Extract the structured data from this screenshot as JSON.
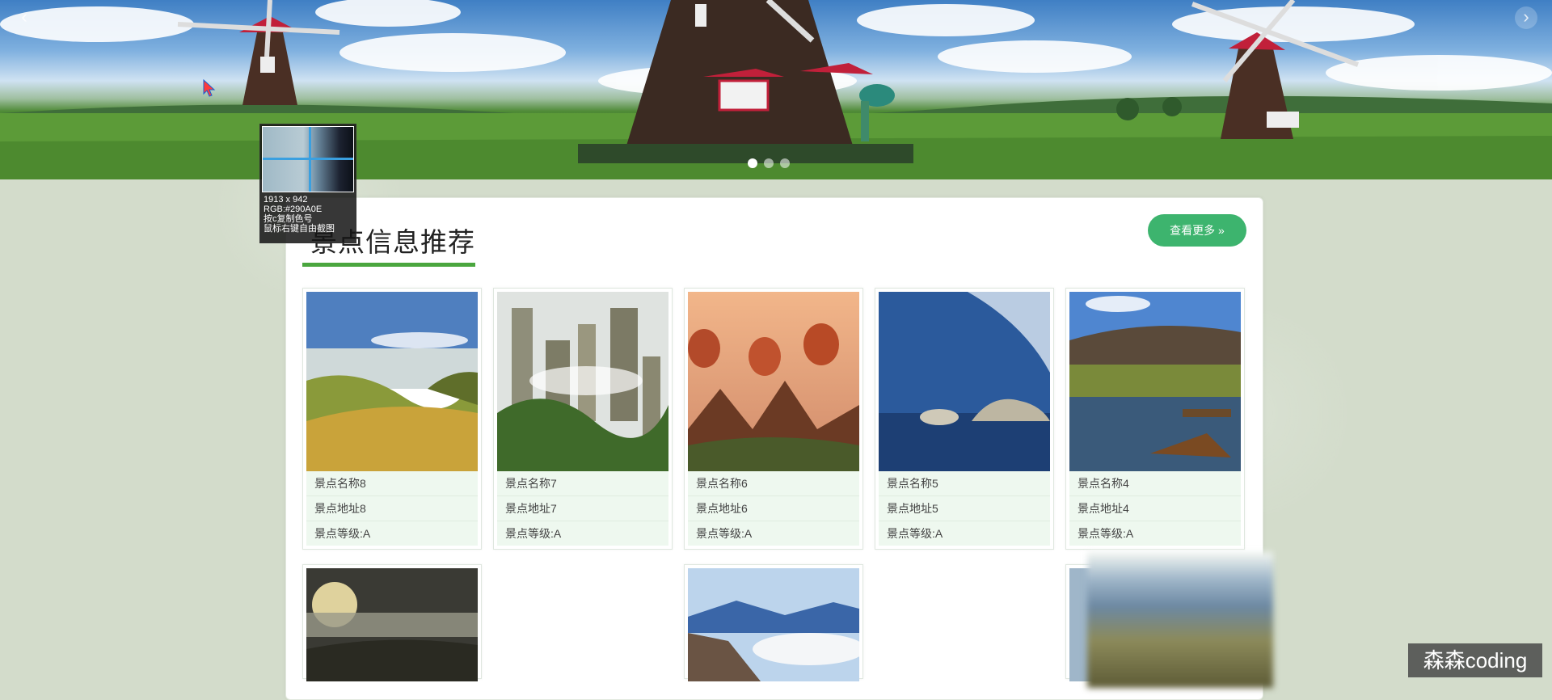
{
  "hero": {
    "prev_icon": "chevron-left-icon",
    "next_icon": "chevron-right-icon",
    "prev_label": "‹",
    "next_label": "›",
    "slide_count": 3,
    "active_slide": 1
  },
  "section": {
    "title": "景点信息推荐",
    "more_button": "查看更多 »"
  },
  "attractions": [
    {
      "name": "景点名称8",
      "address": "景点地址8",
      "level": "景点等级:A",
      "theme": "coast-hills"
    },
    {
      "name": "景点名称7",
      "address": "景点地址7",
      "level": "景点等级:A",
      "theme": "stone-pillars"
    },
    {
      "name": "景点名称6",
      "address": "景点地址6",
      "level": "景点等级:A",
      "theme": "balloons-temples"
    },
    {
      "name": "景点名称5",
      "address": "景点地址5",
      "level": "景点等级:A",
      "theme": "sea-rocks"
    },
    {
      "name": "景点名称4",
      "address": "景点地址4",
      "level": "景点等级:A",
      "theme": "lake-boats"
    },
    {
      "name": "",
      "address": "",
      "level": "",
      "theme": "sunrise-clouds"
    },
    {
      "name": "",
      "address": "",
      "level": "",
      "theme": "snow-mountains"
    }
  ],
  "picker": {
    "size": "1913 x 942",
    "rgb": "RGB:#290A0E",
    "hint1": "按c复制色号",
    "hint2": "鼠标右键自由截图"
  },
  "watermark": "森森coding",
  "colors": {
    "accent_green": "#3db46e",
    "underline_green": "#4aa63e",
    "card_info_bg": "#eef8ef",
    "page_bg": "#d3dccb"
  }
}
